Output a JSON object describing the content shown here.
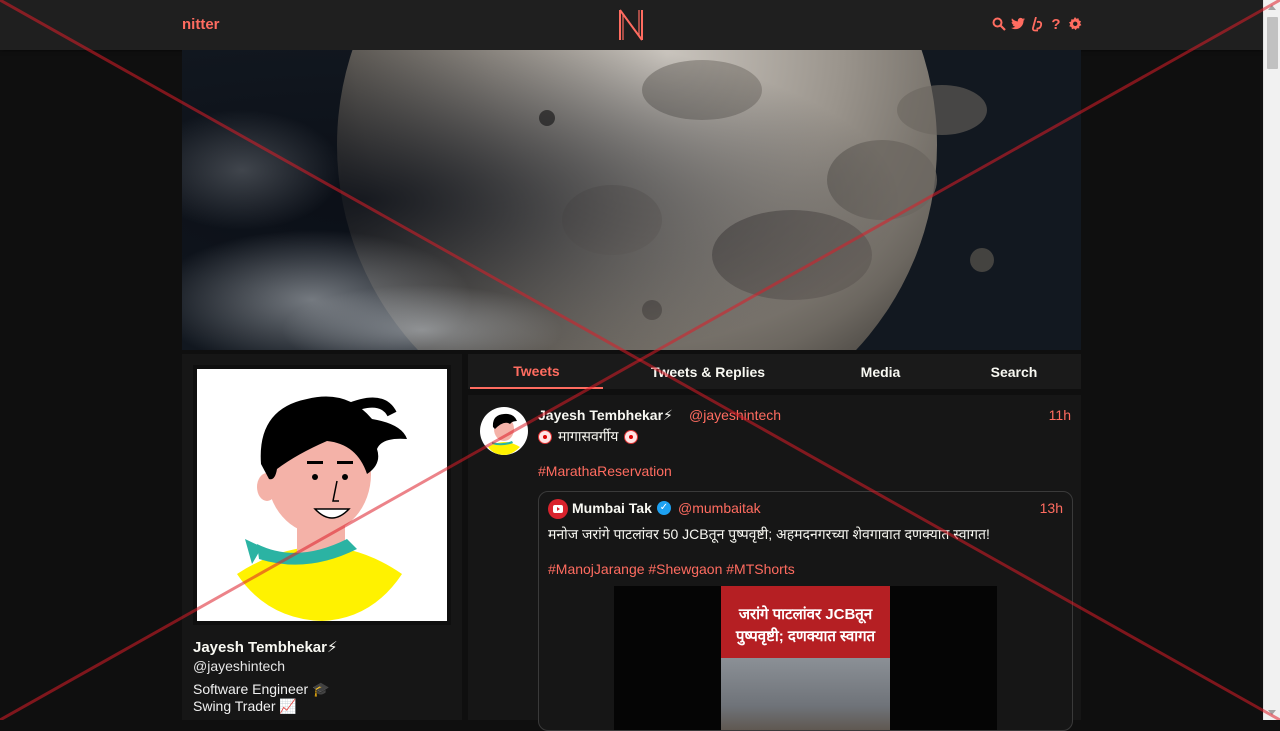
{
  "navbar": {
    "brand": "nitter",
    "logo": "N",
    "icons": [
      "search-icon",
      "twitter-icon",
      "liberapay-icon",
      "help-icon",
      "gear-icon"
    ],
    "help_label": "?"
  },
  "profile": {
    "name": "Jayesh Tembhekar⚡",
    "handle": "@jayeshintech",
    "bio": [
      "Software Engineer 🎓",
      "Swing Trader 📈"
    ]
  },
  "tabs": [
    {
      "label": "Tweets",
      "active": true
    },
    {
      "label": "Tweets & Replies",
      "active": false
    },
    {
      "label": "Media",
      "active": false
    },
    {
      "label": "Search",
      "active": false
    }
  ],
  "tweet": {
    "author": "Jayesh Tembhekar⚡",
    "handle": "@jayeshintech",
    "date": "11h",
    "text": "मागासवर्गीय",
    "hashtag": "#MarathaReservation",
    "quote": {
      "author": "Mumbai Tak",
      "handle": "@mumbaitak",
      "date": "13h",
      "text": "मनोज जरांगे पाटलांवर 50 JCBतून पुष्पवृष्टी; अहमदनगरच्या शेवगावात दणक्यात स्वागत!",
      "hashtags": "#ManojJarange #Shewgaon #MTShorts",
      "thumbnail_text": [
        "जरांगे पाटलांवर JCBतून",
        "पुष्पवृष्टी; दणक्यात स्वागत"
      ]
    }
  },
  "colors": {
    "accent": "#ff6c60",
    "background": "#0f0f0f",
    "panel": "#161616",
    "navbar": "#1f1f1f"
  }
}
